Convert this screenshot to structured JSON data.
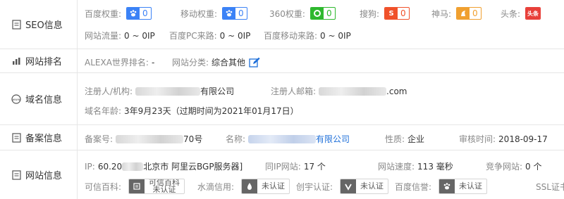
{
  "seo": {
    "label": "SEO信息",
    "baidu_weight": {
      "label": "百度权重:",
      "value": "0"
    },
    "mobile_weight": {
      "label": "移动权重:",
      "value": "0"
    },
    "weight_360": {
      "label": "360权重:",
      "value": "0"
    },
    "sogou": {
      "label": "搜狗:",
      "value": "0",
      "icon_text": "S"
    },
    "shenma": {
      "label": "神马:",
      "value": "0"
    },
    "toutiao": {
      "label": "头条:",
      "icon_text": "头条"
    },
    "traffic": {
      "label": "网站流量:",
      "value": "0 ~ 0IP"
    },
    "baidu_pc": {
      "label": "百度PC来路:",
      "value": "0 ~ 0IP"
    },
    "baidu_mobile": {
      "label": "百度移动来路:",
      "value": "0 ~ 0IP"
    }
  },
  "ranking": {
    "label": "网站排名",
    "alexa": {
      "label": "ALEXA世界排名:",
      "value": "-"
    },
    "category": {
      "label": "网站分类:",
      "value": "综合其他"
    }
  },
  "domain": {
    "label": "域名信息",
    "registrant": {
      "label": "注册人/机构:",
      "value_suffix": "有限公司"
    },
    "email": {
      "label": "注册人邮箱:",
      "value_suffix": ".com"
    },
    "age": {
      "label": "域名年龄:",
      "value": "3年9月23天（过期时间为2021年01月17日）"
    }
  },
  "beian": {
    "label": "备案信息",
    "number": {
      "label": "备案号:",
      "value_suffix": "70号"
    },
    "name": {
      "label": "名称:",
      "value_suffix": "有限公司"
    },
    "nature": {
      "label": "性质:",
      "value": "企业"
    },
    "review_time": {
      "label": "审核时间:",
      "value": "2018-09-17"
    }
  },
  "website": {
    "label": "网站信息",
    "ip": {
      "label": "IP:",
      "value_prefix": "60.20",
      "value_suffix": "北京市 阿里云BGP服务器]"
    },
    "same_ip": {
      "label": "同IP网站:",
      "value": "17 个"
    },
    "speed": {
      "label": "网站速度:",
      "value": "113 毫秒"
    },
    "competitors": {
      "label": "竞争网站:",
      "value": "0 个"
    },
    "kexin": {
      "label": "可信百科:",
      "cert_line1": "可信百科",
      "cert_line2": "未认证"
    },
    "shuidi": {
      "label": "水滴信用:",
      "cert": "未认证"
    },
    "chuangyu": {
      "label": "创宇认证:",
      "cert": "未认证"
    },
    "baidu_xinyu": {
      "label": "百度信誉:",
      "cert": "未认证"
    },
    "ssl": {
      "label": "SSL证书"
    }
  },
  "colors": {
    "baidu_blue": "#3b82f6",
    "q360_green": "#2eb82e",
    "sogou_orange": "#f0512a",
    "shenma_orange": "#f0a030",
    "toutiao_red": "#e8403a",
    "link_blue": "#1e6fd9"
  }
}
